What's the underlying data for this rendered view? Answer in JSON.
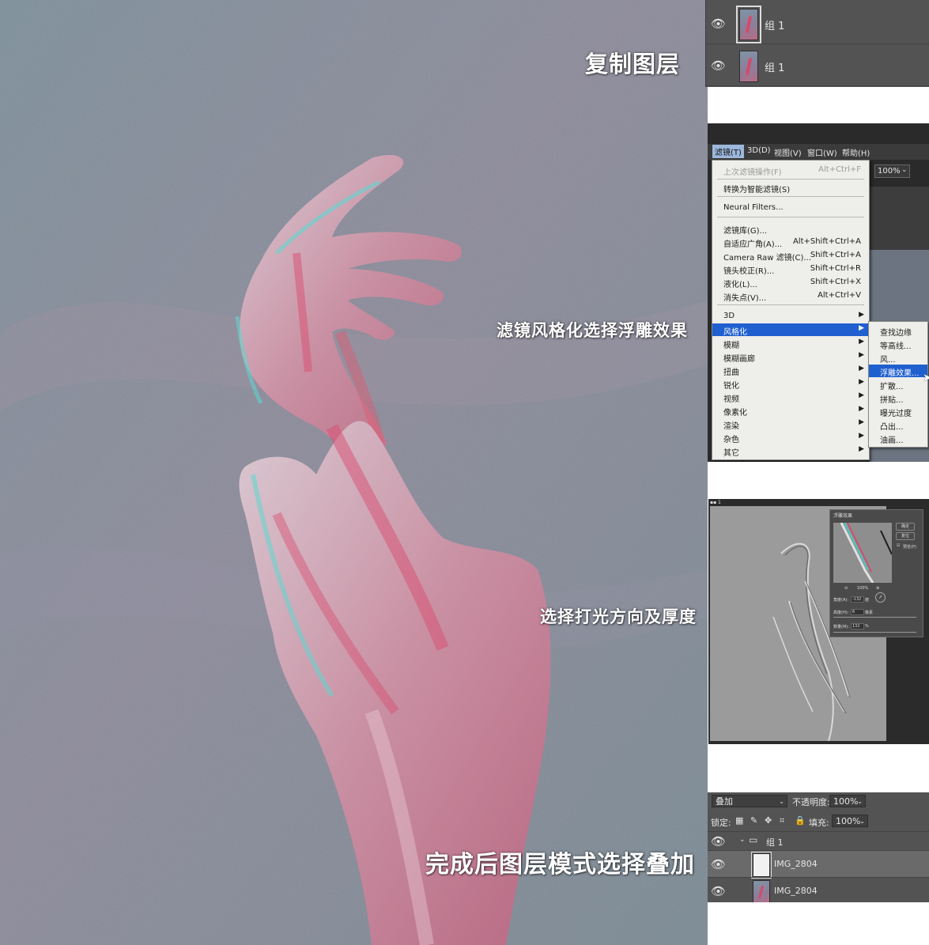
{
  "captions": {
    "duplicate": "复制图层",
    "filter": "滤镜风格化选择浮雕效果",
    "light": "选择打光方向及厚度",
    "overlay": "完成后图层模式选择叠加"
  },
  "layers_panel": {
    "rows": [
      {
        "name": "组 1",
        "selected": true
      },
      {
        "name": "组 1",
        "selected": false
      }
    ]
  },
  "filter_menu": {
    "menubar": [
      "滤镜(T)",
      "3D(D)",
      "视图(V)",
      "窗口(W)",
      "帮助(H)"
    ],
    "zoom": "100%",
    "items": [
      {
        "label": "上次滤镜操作(F)",
        "shortcut": "Alt+Ctrl+F",
        "disabled": true
      },
      {
        "label": "转换为智能滤镜(S)",
        "shortcut": ""
      },
      {
        "label": "Neural Filters...",
        "shortcut": ""
      },
      {
        "label": "滤镜库(G)...",
        "shortcut": ""
      },
      {
        "label": "自适应广角(A)...",
        "shortcut": "Alt+Shift+Ctrl+A"
      },
      {
        "label": "Camera Raw 滤镜(C)...",
        "shortcut": "Shift+Ctrl+A"
      },
      {
        "label": "镜头校正(R)...",
        "shortcut": "Shift+Ctrl+R"
      },
      {
        "label": "液化(L)...",
        "shortcut": "Shift+Ctrl+X"
      },
      {
        "label": "消失点(V)...",
        "shortcut": "Alt+Ctrl+V"
      },
      {
        "label": "3D",
        "shortcut": ""
      },
      {
        "label": "风格化",
        "shortcut": ""
      },
      {
        "label": "模糊",
        "shortcut": ""
      },
      {
        "label": "模糊画廊",
        "shortcut": ""
      },
      {
        "label": "扭曲",
        "shortcut": ""
      },
      {
        "label": "锐化",
        "shortcut": ""
      },
      {
        "label": "视频",
        "shortcut": ""
      },
      {
        "label": "像素化",
        "shortcut": ""
      },
      {
        "label": "渲染",
        "shortcut": ""
      },
      {
        "label": "杂色",
        "shortcut": ""
      },
      {
        "label": "其它",
        "shortcut": ""
      }
    ],
    "submenu": [
      "查找边缘",
      "等高线...",
      "风...",
      "浮雕效果...",
      "扩散...",
      "拼贴...",
      "曝光过度",
      "凸出...",
      "油画..."
    ]
  },
  "emboss_dialog": {
    "title": "浮雕效果",
    "ok": "确定",
    "reset": "复位",
    "preview_label": "预览(P)",
    "zoom": "100%",
    "angle_label": "角度(A):",
    "angle_value": "-132",
    "angle_unit": "度",
    "height_label": "高度(H):",
    "height_value": "6",
    "height_unit": "像素",
    "amount_label": "数量(M):",
    "amount_value": "132",
    "amount_unit": "%"
  },
  "blend_panel": {
    "mode": "叠加",
    "opacity_label": "不透明度:",
    "opacity": "100%",
    "lock_label": "锁定:",
    "fill_label": "填充:",
    "fill": "100%",
    "group": "组 1",
    "layers": [
      "IMG_2804",
      "IMG_2804"
    ]
  },
  "colors": {
    "menu_highlight": "#1f5fcf",
    "panel_bg": "#535353"
  }
}
